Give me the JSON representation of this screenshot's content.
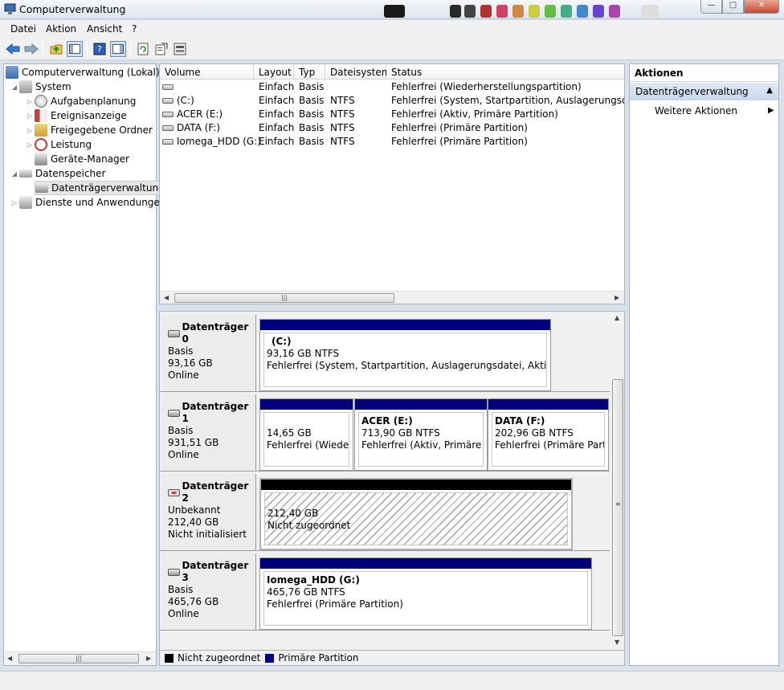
{
  "window": {
    "title": "Computerverwaltung"
  },
  "menu": [
    "Datei",
    "Aktion",
    "Ansicht",
    "?"
  ],
  "tree": {
    "root": "Computerverwaltung (Lokal)",
    "system": "System",
    "aufgabenplanung": "Aufgabenplanung",
    "ereignisanzeige": "Ereignisanzeige",
    "freigegebene": "Freigegebene Ordner",
    "leistung": "Leistung",
    "geraete": "Geräte-Manager",
    "datenspeicher": "Datenspeicher",
    "datentraegerverwaltung": "Datenträgerverwaltung",
    "dienste": "Dienste und Anwendungen"
  },
  "volume_list": {
    "headers": [
      "Volume",
      "Layout",
      "Typ",
      "Dateisystem",
      "Status"
    ],
    "rows": [
      {
        "volume": "",
        "layout": "Einfach",
        "typ": "Basis",
        "fs": "",
        "status": "Fehlerfrei (Wiederherstellungspartition)"
      },
      {
        "volume": "(C:)",
        "layout": "Einfach",
        "typ": "Basis",
        "fs": "NTFS",
        "status": "Fehlerfrei (System, Startpartition, Auslagerungsdatei, Ak"
      },
      {
        "volume": "ACER (E:)",
        "layout": "Einfach",
        "typ": "Basis",
        "fs": "NTFS",
        "status": "Fehlerfrei (Aktiv, Primäre Partition)"
      },
      {
        "volume": "DATA (F:)",
        "layout": "Einfach",
        "typ": "Basis",
        "fs": "NTFS",
        "status": "Fehlerfrei (Primäre Partition)"
      },
      {
        "volume": "Iomega_HDD (G:)",
        "layout": "Einfach",
        "typ": "Basis",
        "fs": "NTFS",
        "status": "Fehlerfrei (Primäre Partition)"
      }
    ]
  },
  "disks": [
    {
      "name": "Datenträger 0",
      "type": "Basis",
      "size": "93,16 GB",
      "state": "Online"
    },
    {
      "name": "Datenträger 1",
      "type": "Basis",
      "size": "931,51 GB",
      "state": "Online"
    },
    {
      "name": "Datenträger 2",
      "type": "Unbekannt",
      "size": "212,40 GB",
      "state": "Nicht initialisiert"
    },
    {
      "name": "Datenträger 3",
      "type": "Basis",
      "size": "465,76 GB",
      "state": "Online"
    }
  ],
  "partitions": {
    "d0p0": {
      "name": "(C:)",
      "size": "93,16 GB NTFS",
      "status": "Fehlerfrei (System, Startpartition, Auslagerungsdatei, Aktiv, Abstur"
    },
    "d1p0": {
      "size": "14,65 GB",
      "status": "Fehlerfrei (Wiederhe"
    },
    "d1p1": {
      "name": "ACER  (E:)",
      "size": "713,90 GB NTFS",
      "status": "Fehlerfrei (Aktiv, Primäre Par"
    },
    "d1p2": {
      "name": "DATA  (F:)",
      "size": "202,96 GB NTFS",
      "status": "Fehlerfrei (Primäre Partitic"
    },
    "d2p0": {
      "size": "212,40 GB",
      "status": "Nicht zugeordnet"
    },
    "d3p0": {
      "name": "Iomega_HDD  (G:)",
      "size": "465,76 GB NTFS",
      "status": "Fehlerfrei (Primäre Partition)"
    }
  },
  "legend": {
    "unallocated": "Nicht zugeordnet",
    "primary": "Primäre Partition"
  },
  "actions": {
    "header": "Aktionen",
    "section": "Datenträgerverwaltung",
    "more": "Weitere Aktionen"
  },
  "colors": {
    "primary": "#00007f",
    "unallocated": "#000000",
    "selection": "#cfdff3"
  }
}
